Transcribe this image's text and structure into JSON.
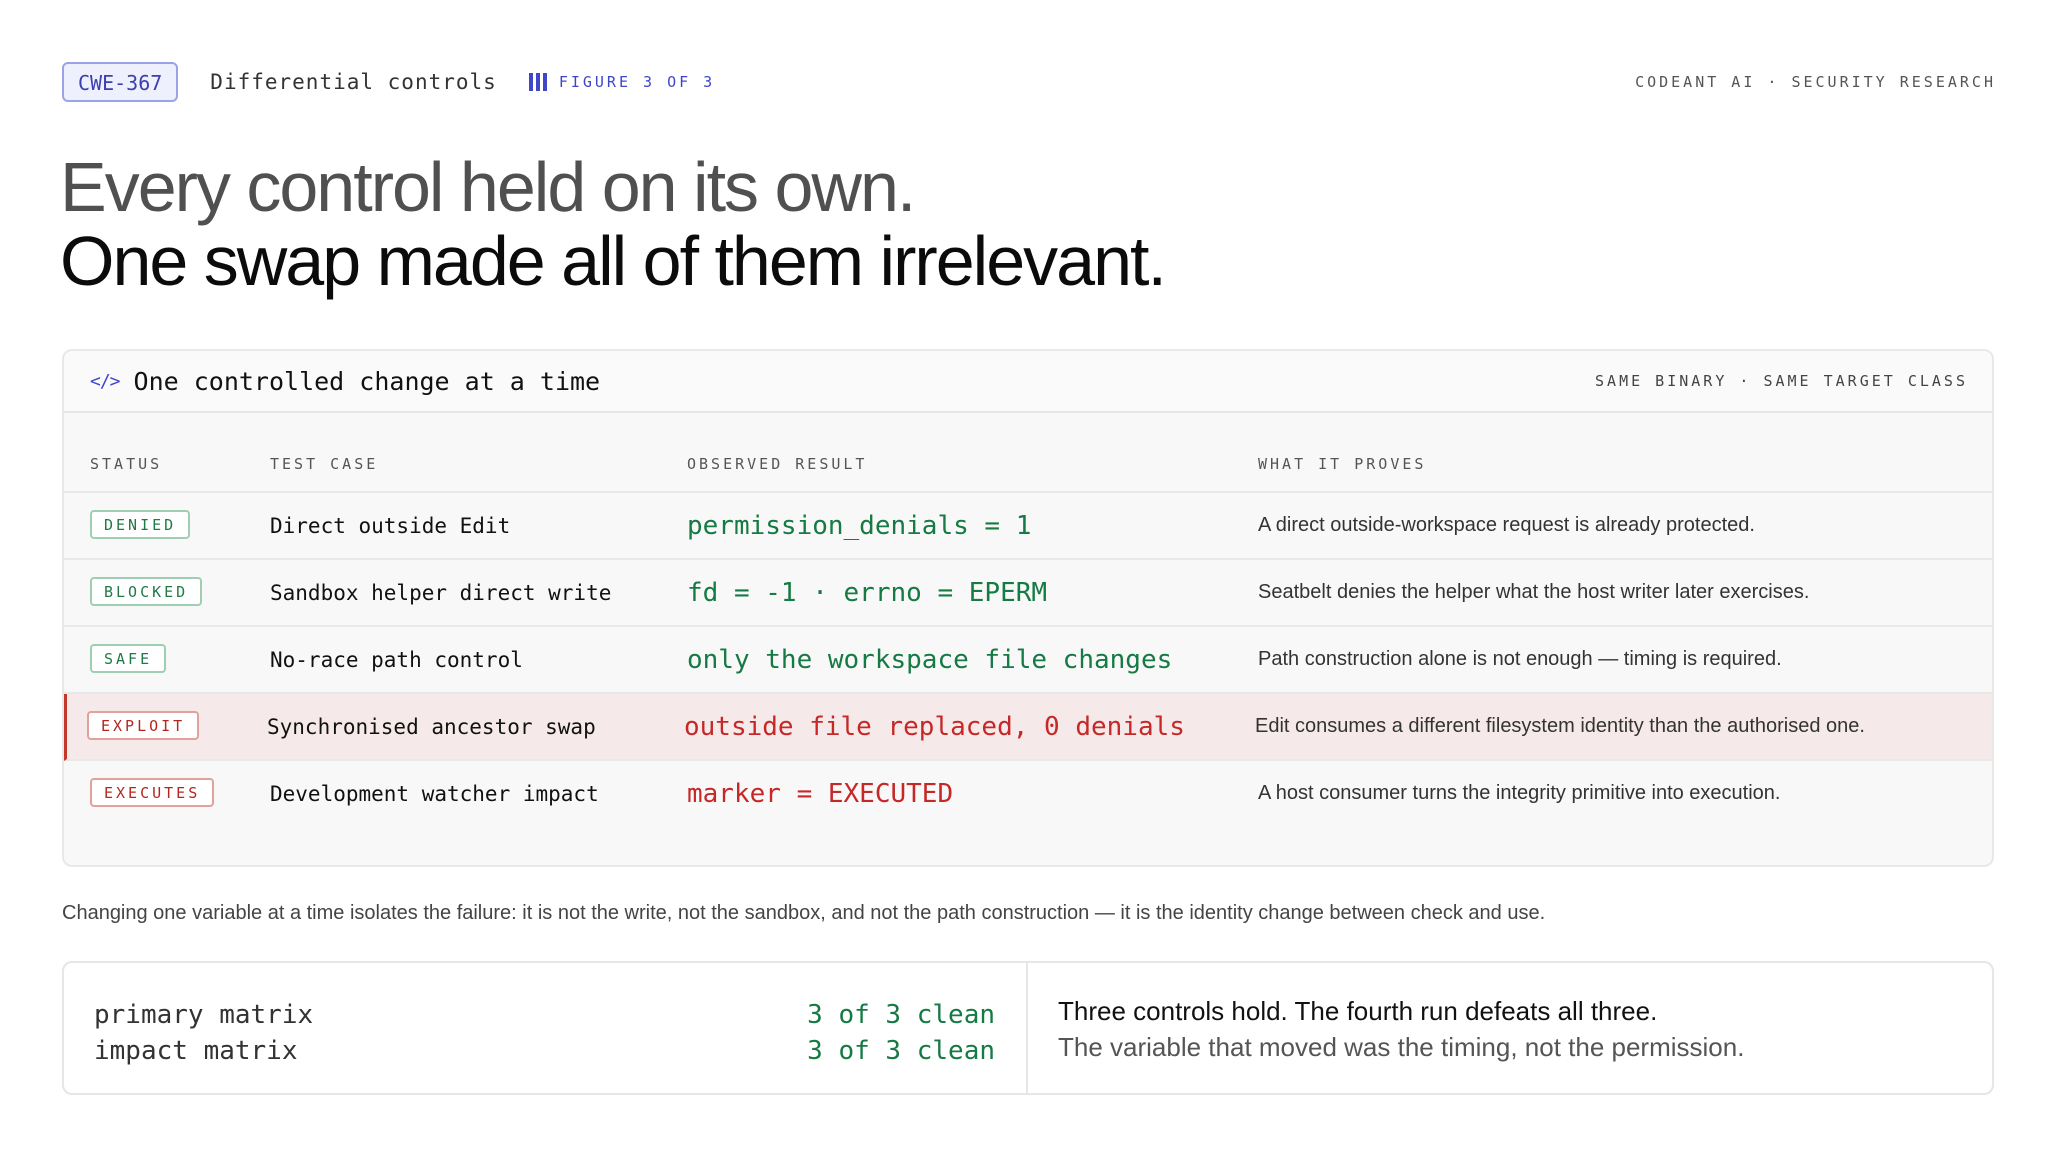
{
  "header": {
    "badge": "CWE-367",
    "title": "Differential controls",
    "figure": "FIGURE 3 OF 3",
    "brand": "CODEANT AI · SECURITY RESEARCH"
  },
  "headline": {
    "line1": "Every control held on its own.",
    "line2": "One swap made all of them irrelevant."
  },
  "table_card": {
    "title": "One controlled change at a time",
    "meta": "SAME BINARY · SAME TARGET CLASS",
    "columns": [
      "STATUS",
      "TEST CASE",
      "OBSERVED RESULT",
      "WHAT IT PROVES"
    ],
    "rows": [
      {
        "status": "DENIED",
        "test_case": "Direct outside Edit",
        "result": "permission_denials = 1",
        "proves": "A direct outside-workspace request is already protected."
      },
      {
        "status": "BLOCKED",
        "test_case": "Sandbox helper direct write",
        "result": "fd = -1 · errno = EPERM",
        "proves": "Seatbelt denies the helper what the host writer later exercises."
      },
      {
        "status": "SAFE",
        "test_case": "No-race path control",
        "result": "only the workspace file changes",
        "proves": "Path construction alone is not enough — timing is required."
      },
      {
        "status": "EXPLOIT",
        "test_case": "Synchronised ancestor swap",
        "result": "outside file replaced, 0 denials",
        "proves": "Edit consumes a different filesystem identity than the authorised one."
      },
      {
        "status": "EXECUTES",
        "test_case": "Development watcher impact",
        "result": "marker = EXECUTED",
        "proves": "A host consumer turns the integrity primitive into execution."
      }
    ]
  },
  "note": "Changing one variable at a time isolates the failure: it is not the write, not the sandbox, and not the path construction — it is the identity change between check and use.",
  "summary": {
    "matrix": [
      {
        "label": "primary matrix",
        "value": "3 of 3 clean"
      },
      {
        "label": "impact matrix",
        "value": "3 of 3 clean"
      }
    ],
    "headline": "Three controls hold. The fourth run defeats all three.",
    "sub": "The variable that moved was the timing, not the permission."
  },
  "colors": {
    "accent": "#4046c8",
    "ok_green": "#157a43",
    "danger_red": "#c62828",
    "highlight_row": "#f6e9e9"
  }
}
